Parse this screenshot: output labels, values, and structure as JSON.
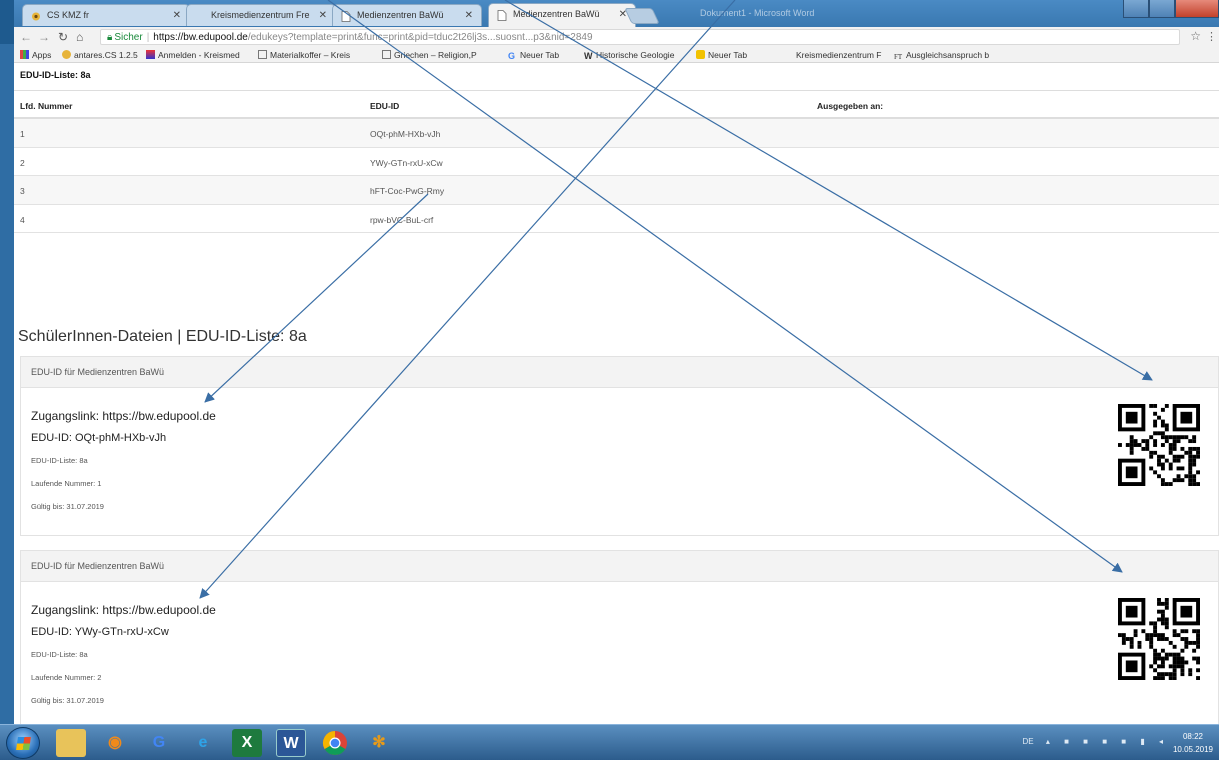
{
  "browser": {
    "tabs": [
      {
        "label": "CS KMZ fr",
        "active": false
      },
      {
        "label": "Kreismedienzentrum Fre",
        "active": false
      },
      {
        "label": "Medienzentren BaWü",
        "active": false
      },
      {
        "label": "Medienzentren BaWü",
        "active": true
      }
    ],
    "ghost_window_title": "Dokument1 - Microsoft Word",
    "security_label": "Sicher",
    "url_host": "https://bw.edupool.de",
    "url_path": "/edukeys?template=print&func=print&pid=tduc2t26lj3s...suosnt...p3&nid=2849",
    "bookmarks": [
      "Apps",
      "antares.CS 1.2.5",
      "Anmelden - Kreismed",
      "Materialkoffer – Kreis",
      "Griechen – Religion,P",
      "Neuer Tab",
      "Historische Geologie",
      "Neuer Tab",
      "Kreismedienzentrum F",
      "Ausgleichsanspruch b"
    ]
  },
  "list": {
    "title": "EDU-ID-Liste: 8a",
    "headers": [
      "Lfd. Nummer",
      "EDU-ID",
      "Ausgegeben an:"
    ],
    "rows": [
      {
        "num": "1",
        "id": "OQt-phM-HXb-vJh",
        "issued": ""
      },
      {
        "num": "2",
        "id": "YWy-GTn-rxU-xCw",
        "issued": ""
      },
      {
        "num": "3",
        "id": "hFT-Coc-PwG-Rmy",
        "issued": ""
      },
      {
        "num": "4",
        "id": "rpw-bVC-BuL-crf",
        "issued": ""
      }
    ]
  },
  "section_title": "SchülerInnen-Dateien | EDU-ID-Liste: 8a",
  "cards": [
    {
      "header": "EDU-ID für Medienzentren BaWü",
      "link": "Zugangslink: https://bw.edupool.de",
      "eduid": "EDU-ID: OQt-phM-HXb-vJh",
      "list": "EDU-ID-Liste: 8a",
      "number": "Laufende Nummer: 1",
      "valid": "Gültig bis: 31.07.2019"
    },
    {
      "header": "EDU-ID für Medienzentren BaWü",
      "link": "Zugangslink: https://bw.edupool.de",
      "eduid": "EDU-ID: YWy-GTn-rxU-xCw",
      "list": "EDU-ID-Liste: 8a",
      "number": "Laufende Nummer: 2",
      "valid": "Gültig bis: 31.07.2019"
    }
  ],
  "taskbar": {
    "lang": "DE",
    "time": "08:22",
    "date": "10.05.2019"
  },
  "colors": {
    "arrow": "#3a6ea5",
    "secure_green": "#1a8a3c"
  }
}
